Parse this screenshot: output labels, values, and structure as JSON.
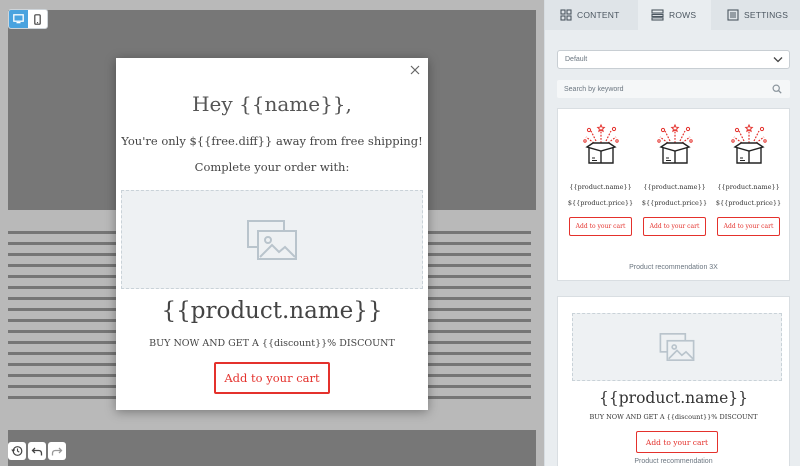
{
  "editor": {
    "device_modes": [
      "desktop",
      "mobile"
    ],
    "active_device": "desktop"
  },
  "popup": {
    "title": "Hey {{name}},",
    "line1": "You're only ${{free.diff}} away from free shipping!",
    "line2": "Complete your order with:",
    "product_name": "{{product.name}}",
    "discount_text": "BUY NOW AND GET A {{discount}}% DISCOUNT",
    "cta_label": "Add to your cart"
  },
  "panel": {
    "tabs": [
      {
        "label": "CONTENT",
        "icon": "grid-icon"
      },
      {
        "label": "ROWS",
        "icon": "rows-icon"
      },
      {
        "label": "SETTINGS",
        "icon": "settings-icon"
      }
    ],
    "active_tab": "ROWS",
    "select_value": "Default",
    "search_placeholder": "Search by keyword",
    "cards": [
      {
        "caption": "Product recommendation 3X",
        "products": [
          {
            "name": "{{product.name}}",
            "price": "${{product.price}}",
            "cta": "Add to your cart"
          },
          {
            "name": "{{product.name}}",
            "price": "${{product.price}}",
            "cta": "Add to your cart"
          },
          {
            "name": "{{product.name}}",
            "price": "${{product.price}}",
            "cta": "Add to your cart"
          }
        ]
      },
      {
        "caption": "Product recommendation",
        "product_name": "{{product.name}}",
        "discount_text": "BUY NOW AND GET A {{discount}}% DISCOUNT",
        "cta": "Add to your cart"
      }
    ]
  },
  "colors": {
    "accent_red": "#e4312c",
    "active_blue": "#4aa3df",
    "panel_bg": "#e9edf0"
  }
}
